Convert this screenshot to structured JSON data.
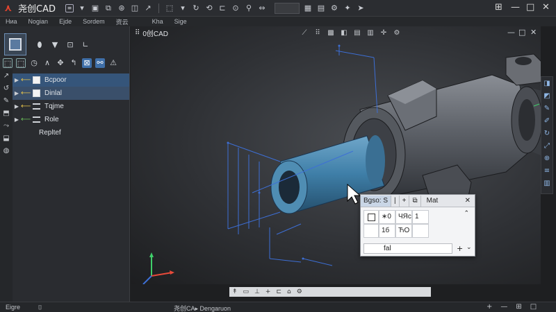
{
  "app": {
    "title": "尧创CAD",
    "document_tab": "0创CAD"
  },
  "toolbar_icons": [
    "file-icon",
    "image-icon",
    "layers-icon",
    "globe-icon",
    "cube-icon",
    "arrow-icon",
    "select-icon",
    "measure-icon",
    "rotate-icon",
    "pan-icon",
    "search-icon"
  ],
  "window_controls": {
    "tile": "⊞",
    "minimize": "—",
    "maximize": "□",
    "close": "✕"
  },
  "menu": [
    "Ниа",
    "Nogian",
    "Ejde",
    "Sordem",
    "资云",
    "Kha",
    "Sige"
  ],
  "tree": {
    "items": [
      {
        "label": "Bcpoor"
      },
      {
        "label": "Dinlal"
      },
      {
        "label": "Tqjme"
      },
      {
        "label": "Role"
      },
      {
        "label": "Repltef"
      }
    ]
  },
  "properties_panel": {
    "tabs": [
      "Bgso: S",
      "|",
      "+",
      "⧉"
    ],
    "title": "Mat",
    "grid": {
      "row1": [
        "",
        "∗0",
        "ЧЯс",
        "1"
      ],
      "row2": [
        "",
        "1б",
        "ЋО",
        ""
      ]
    },
    "input_value": "fal",
    "colors": {
      "accent": "#3f6fa8",
      "part_highlight": "#3f7fa8",
      "dimension": "#3d6fd6"
    }
  },
  "statusbar": {
    "left": "Eigre",
    "left_icon": "⌷",
    "center": "尧创CA▸ Dengaruon",
    "right": [
      "+",
      "—",
      "⊞",
      "□"
    ]
  }
}
